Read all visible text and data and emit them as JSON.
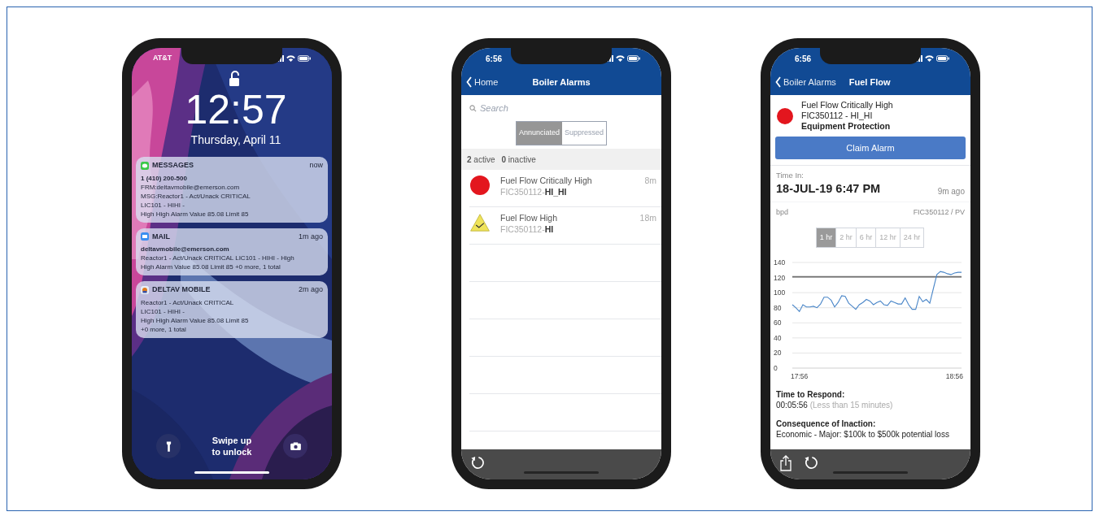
{
  "phones": [
    {
      "kind": "lock_screen",
      "status_bar": {
        "carrier": "AT&T"
      },
      "time": "12:57",
      "date": "Thursday, April 11",
      "notifications": [
        {
          "app": "MESSAGES",
          "kind": "messages",
          "time": "now",
          "title": "1 (410) 200-500",
          "lines": [
            "FRM:deltavmobile@emerson.com",
            "MSG:Reactor1 - Act/Unack CRITICAL",
            "LIC101 - HIHI -",
            "High High Alarm Value 85.08 Limit 85"
          ]
        },
        {
          "app": "MAIL",
          "kind": "mail",
          "time": "1m ago",
          "title": "deltavmobile@emerson.com",
          "lines": [
            "Reactor1 - Act/Unack CRITICAL LIC101 - HIHI - High",
            "High Alarm Value 85.08 Limit 85 +0 more, 1 total"
          ]
        },
        {
          "app": "DELTAV MOBILE",
          "kind": "app",
          "time": "2m ago",
          "lines": [
            "Reactor1 - Act/Unack CRITICAL",
            "LIC101 - HIHI -",
            "High High Alarm Value 85.08 Limit 85",
            "+0 more, 1 total"
          ]
        }
      ],
      "unlock_hint": "Swipe up to unlock"
    },
    {
      "kind": "alarm_list",
      "status_bar": {
        "time": "6:56"
      },
      "back": "Home",
      "title": "Boiler Alarms",
      "search_placeholder": "Search",
      "segments": [
        {
          "label": "Annunciated",
          "selected": true
        },
        {
          "label": "Suppressed",
          "selected": false
        }
      ],
      "summary": [
        {
          "count": "2",
          "label": "active"
        },
        {
          "count": "0",
          "label": "inactive"
        }
      ],
      "alarms": [
        {
          "kind": "critical",
          "title": "Fuel Flow Critically High",
          "tag": "FIC350112-**HI_HI**",
          "age": "8m"
        },
        {
          "kind": "high",
          "title": "Fuel Flow High",
          "tag": "FIC350112-**HI**",
          "age": "18m"
        }
      ],
      "toolbar": [
        {
          "kind": "refresh"
        }
      ]
    },
    {
      "kind": "alarm_detail",
      "status_bar": {
        "time": "6:56"
      },
      "back": "Boiler Alarms",
      "title": "Fuel Flow",
      "alarm": {
        "kind": "critical",
        "title": "Fuel Flow Critically High",
        "tag": "FIC350112 - HI_HI",
        "category": "Equipment Protection"
      },
      "claim_button": "Claim Alarm",
      "time_in": {
        "label": "Time In:",
        "value": "18-JUL-19 6:47 PM",
        "ago": "9m ago"
      },
      "trend": {
        "unit": "bpd",
        "source": "FIC350112 / PV",
        "ranges": [
          {
            "label": "1 hr",
            "selected": true
          },
          {
            "label": "2 hr",
            "selected": false
          },
          {
            "label": "6 hr",
            "selected": false
          },
          {
            "label": "12 hr",
            "selected": false
          },
          {
            "label": "24 hr",
            "selected": false
          }
        ],
        "chart_data": {
          "type": "line",
          "categories": [
            null,
            null,
            "17:56",
            null,
            null,
            null,
            null,
            null,
            null,
            null,
            null,
            null,
            null,
            null,
            null,
            null,
            null,
            null,
            null,
            null,
            null,
            null,
            null,
            null,
            null,
            null,
            null,
            null,
            null,
            null,
            null,
            null,
            null,
            null,
            null,
            null,
            null,
            null,
            null,
            null,
            null,
            null,
            null,
            null,
            null,
            null,
            "18:56",
            null,
            null
          ],
          "series": [
            {
              "color": "#4a86c8",
              "values": [
                84,
                80,
                75,
                84,
                81,
                81,
                82,
                80,
                85,
                94,
                94,
                90,
                81,
                87,
                96,
                95,
                86,
                82,
                78,
                84,
                87,
                91,
                89,
                84,
                87,
                89,
                84,
                83,
                89,
                87,
                85,
                85,
                93,
                84,
                78,
                78,
                95,
                88,
                91,
                86,
                105,
                124,
                128,
                127,
                125,
                124,
                126,
                127,
                127
              ]
            }
          ],
          "ylim": [
            0,
            140
          ],
          "yticks": [
            0,
            20,
            40,
            60,
            80,
            100,
            120,
            140
          ],
          "grid": true,
          "ref_lines": [
            {
              "axis": "y",
              "value": 121
            }
          ]
        }
      },
      "details": [
        {
          "label": "Time to Respond:",
          "value": "00:05:56",
          "note": "(Less than 15 minutes)"
        },
        {
          "label": "Consequence of Inaction:",
          "value": "Economic - Major: $100k to $500k potential loss"
        }
      ],
      "toolbar": [
        {
          "kind": "share"
        },
        {
          "kind": "refresh"
        }
      ]
    }
  ]
}
